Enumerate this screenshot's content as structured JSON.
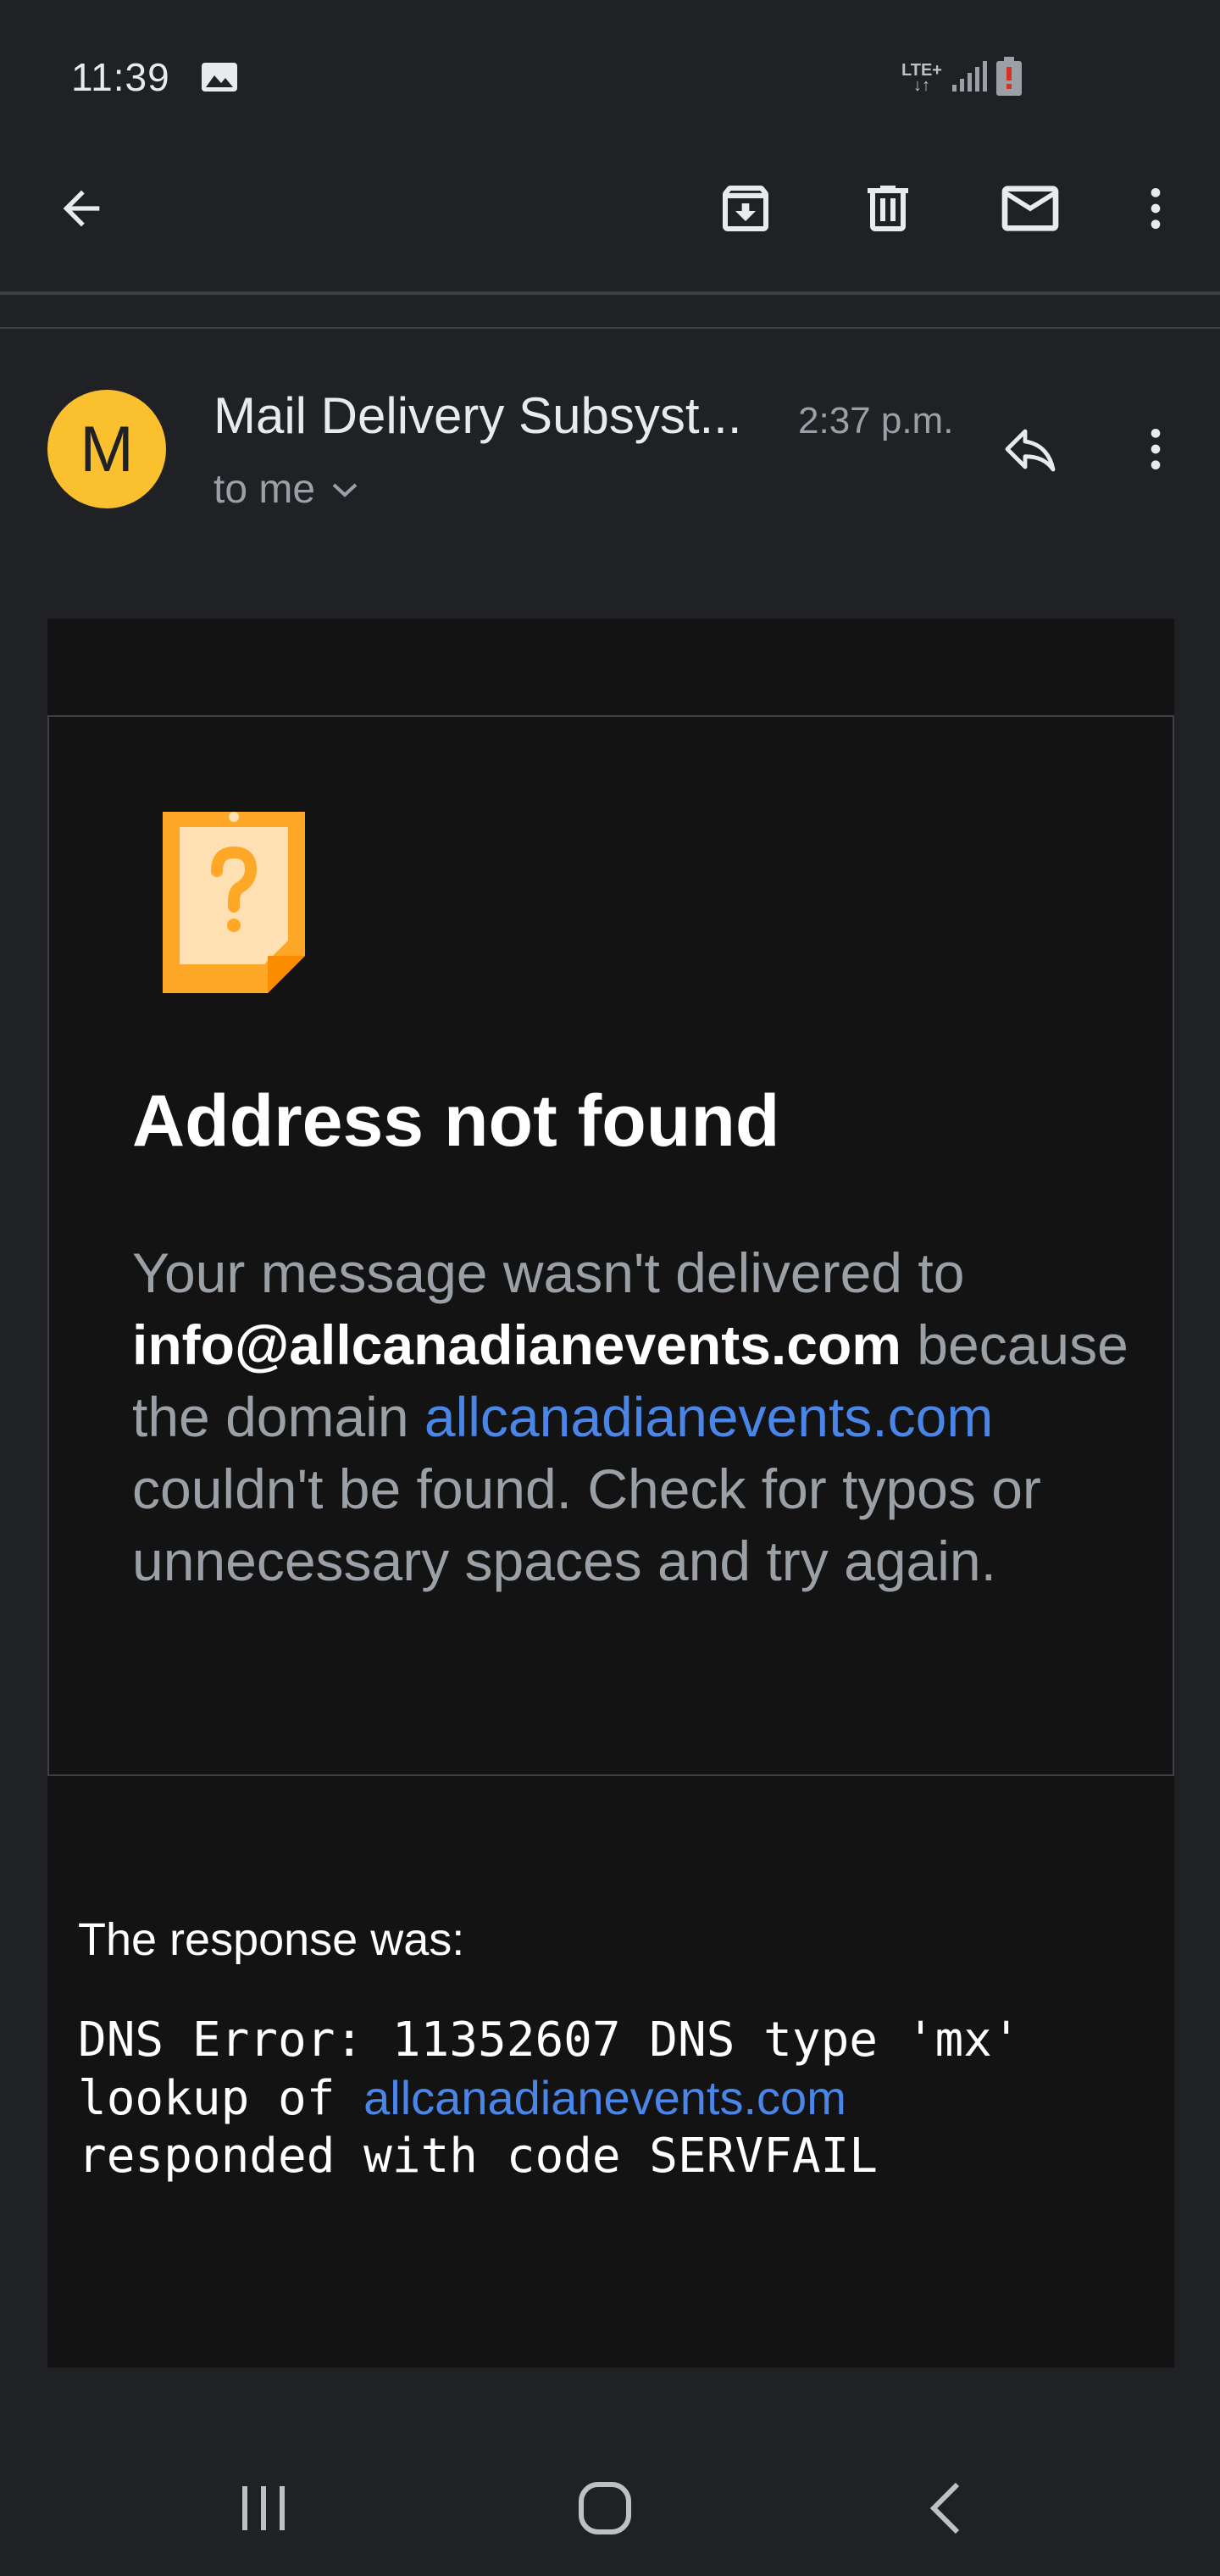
{
  "status_bar": {
    "time": "11:39",
    "network_label": "LTE+",
    "icons": [
      "gallery-icon",
      "signal-icon",
      "battery-icon"
    ]
  },
  "toolbar": {
    "icons": [
      "back-arrow-icon",
      "archive-icon",
      "trash-icon",
      "mail-icon",
      "more-vert-icon"
    ]
  },
  "email": {
    "avatar_letter": "M",
    "sender": "Mail Delivery Subsyst...",
    "time": "2:37 p.m.",
    "recipient": "to me"
  },
  "notice": {
    "title": "Address not found",
    "text_part1": "Your message wasn't delivered to ",
    "email_address": "info@allcanadianevents.com",
    "text_part2": " because the domain ",
    "domain_link": "allcanadianevents.com",
    "text_part3": " couldn't be found. Check for typos or unnecessary spaces and try again."
  },
  "response": {
    "label": "The response was:",
    "line1": "DNS Error: 11352607 DNS type 'mx'",
    "line2_prefix": "lookup of ",
    "line2_link": "allcanadianevents.com",
    "line3": "responded with code SERVFAIL"
  },
  "colors": {
    "background": "#202124",
    "body_background": "#131314",
    "avatar": "#fbc02d",
    "link": "#4a86e8",
    "notice_icon": "#ffa726"
  },
  "nav_bar": {
    "icons": [
      "recent-apps-icon",
      "home-icon",
      "nav-back-icon"
    ]
  }
}
